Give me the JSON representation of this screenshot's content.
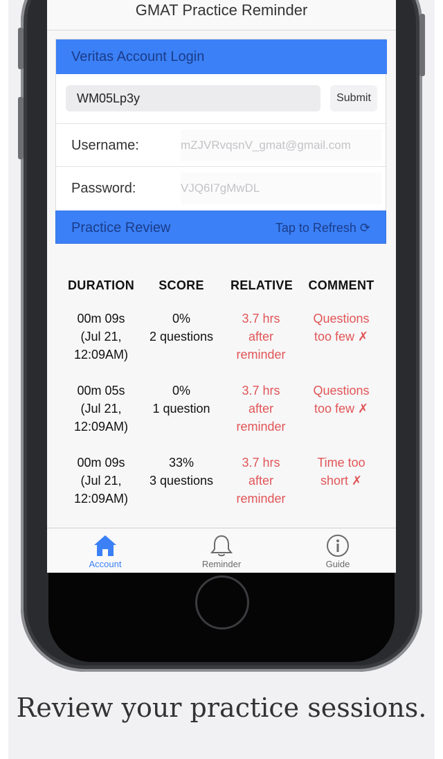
{
  "app": {
    "title": "GMAT Practice Reminder"
  },
  "login": {
    "header": "Veritas Account Login",
    "code_value": "WM05Lp3y",
    "submit_label": "Submit",
    "username_label": "Username:",
    "username_value": "mZJVRvqsnV_gmat@gmail.com",
    "password_label": "Password:",
    "password_value": "VJQ6I7gMwDL"
  },
  "review": {
    "header": "Practice Review",
    "refresh_label": "Tap to Refresh ⟳",
    "columns": [
      "DURATION",
      "SCORE",
      "RELATIVE",
      "COMMENT"
    ],
    "rows": [
      {
        "duration": "00m 09s\n(Jul 21,\n12:09AM)",
        "score": "0%\n2 questions",
        "relative": "3.7 hrs\nafter\nreminder",
        "comment": "Questions\ntoo few ✗"
      },
      {
        "duration": "00m 05s\n(Jul 21,\n12:09AM)",
        "score": "0%\n1 question",
        "relative": "3.7 hrs\nafter\nreminder",
        "comment": "Questions\ntoo few ✗"
      },
      {
        "duration": "00m 09s\n(Jul 21,\n12:09AM)",
        "score": "33%\n3 questions",
        "relative": "3.7 hrs\nafter\nreminder",
        "comment": "Time too\nshort ✗"
      }
    ]
  },
  "tabs": [
    {
      "label": "Account",
      "icon": "house-icon",
      "active": true
    },
    {
      "label": "Reminder",
      "icon": "bell-icon",
      "active": false
    },
    {
      "label": "Guide",
      "icon": "info-icon",
      "active": false
    }
  ],
  "caption": "Review your practice sessions.",
  "colors": {
    "accent_blue": "#3b80f6",
    "header_text": "#1b3c8a",
    "negative_red": "#e15556",
    "tab_active": "#3b80f6",
    "tab_inactive": "#6b6b6b"
  }
}
